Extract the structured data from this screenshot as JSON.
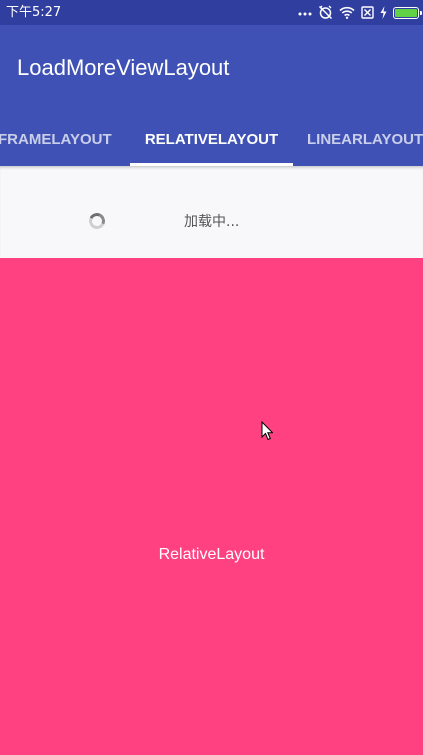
{
  "status_bar": {
    "time": "下午5:27",
    "icons": [
      "more-dots-icon",
      "alarm-off-icon",
      "wifi-icon",
      "sim-blocked-icon",
      "charging-icon",
      "battery-icon"
    ],
    "battery_level": 1.0,
    "battery_color": "#61d245"
  },
  "app_bar": {
    "title": "LoadMoreViewLayout",
    "color": "#3f51b5"
  },
  "tabs": [
    {
      "label": "FRAMELAYOUT",
      "active": false
    },
    {
      "label": "RELATIVELAYOUT",
      "active": true
    },
    {
      "label": "LINEARLAYOUT",
      "active": false
    }
  ],
  "loading": {
    "text": "加载中..."
  },
  "content": {
    "label": "RelativeLayout",
    "color": "#ff4081"
  }
}
